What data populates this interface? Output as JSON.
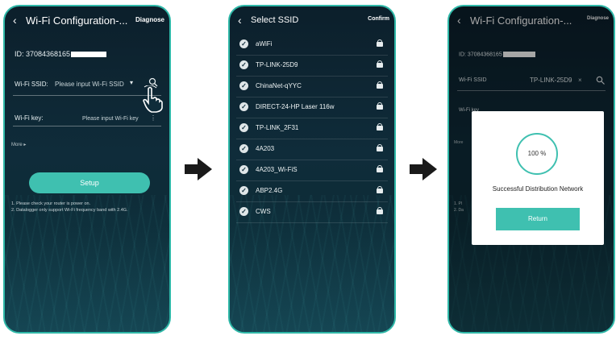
{
  "screen1": {
    "title": "Wi-Fi Configuration-...",
    "diagnose": "Diagnose",
    "id_label": "ID: 37084368165",
    "ssid_label": "Wi-Fi SSID:",
    "ssid_placeholder": "Please input Wi-Fi SSID",
    "key_label": "Wi-Fi key:",
    "key_placeholder": "Please input Wi-Fi key",
    "more": "More ▸",
    "setup": "Setup",
    "note1": "1. Please check your router is power on.",
    "note2": "2. Datalogger only support Wi-Fi frequency band with 2.4G."
  },
  "screen2": {
    "title": "Select SSID",
    "confirm": "Confirm",
    "ssids": [
      "aWiFi",
      "TP-LINK-25D9",
      "ChinaNet-qYYC",
      "DIRECT-24-HP Laser 116w",
      "TP-LINK_2F31",
      "4A203",
      "4A203_Wi-FiS",
      "ABP2.4G",
      "CWS"
    ]
  },
  "screen3": {
    "title": "Wi-Fi Configuration-...",
    "diagnose": "Diagnose",
    "id_label": "ID: 37084368165",
    "ssid_label": "Wi-Fi SSID",
    "ssid_value": "TP-LINK-25D9",
    "key_label": "Wi-Fi key",
    "more": "More",
    "note1": "1. Pl",
    "note2": "2. Da",
    "progress": "100 %",
    "success": "Successful Distribution Network",
    "return": "Return"
  },
  "colors": {
    "accent": "#3fc0b0",
    "frame": "#2fb8a8"
  },
  "icons": {
    "back": "chevron-left-icon",
    "search": "search-icon",
    "check": "check-circle-icon",
    "lock": "lock-icon",
    "arrow": "arrow-right-icon",
    "hand": "hand-pointer-icon"
  }
}
